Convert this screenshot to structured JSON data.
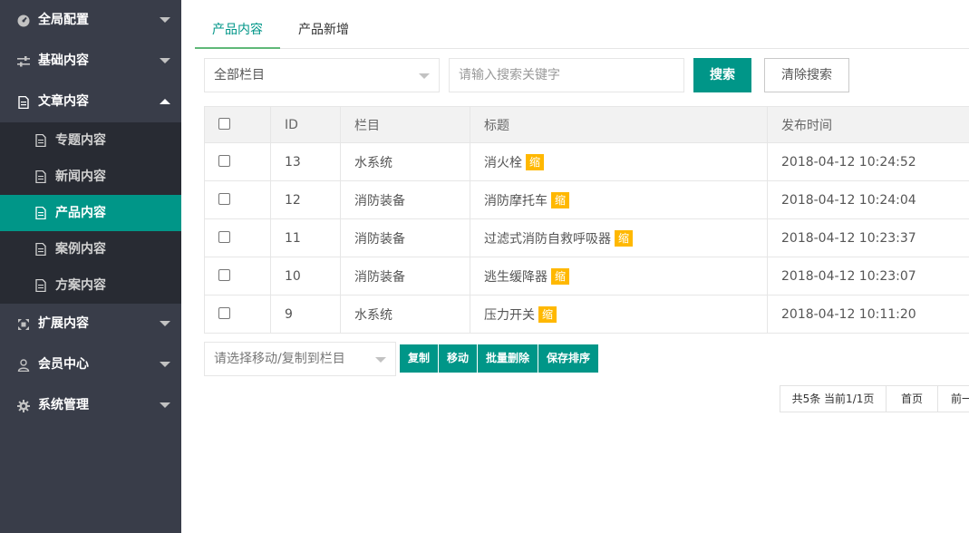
{
  "sidebar": {
    "items": [
      {
        "label": "全局配置",
        "icon": "gauge-icon"
      },
      {
        "label": "基础内容",
        "icon": "sliders-icon"
      },
      {
        "label": "文章内容",
        "icon": "document-icon"
      },
      {
        "label": "扩展内容",
        "icon": "expand-icon"
      },
      {
        "label": "会员中心",
        "icon": "user-icon"
      },
      {
        "label": "系统管理",
        "icon": "gear-icon"
      }
    ],
    "sub_items": [
      {
        "label": "专题内容"
      },
      {
        "label": "新闻内容"
      },
      {
        "label": "产品内容"
      },
      {
        "label": "案例内容"
      },
      {
        "label": "方案内容"
      }
    ]
  },
  "tabs": [
    {
      "label": "产品内容"
    },
    {
      "label": "产品新增"
    }
  ],
  "search": {
    "category_select": "全部栏目",
    "keyword_placeholder": "请输入搜索关键字",
    "search_button": "搜索",
    "clear_button": "清除搜索"
  },
  "table": {
    "headers": [
      "ID",
      "栏目",
      "标题",
      "发布时间"
    ],
    "tag_label": "缩",
    "rows": [
      {
        "id": "13",
        "category": "水系统",
        "title": "消火栓",
        "time": "2018-04-12 10:24:52"
      },
      {
        "id": "12",
        "category": "消防装备",
        "title": "消防摩托车",
        "time": "2018-04-12 10:24:04"
      },
      {
        "id": "11",
        "category": "消防装备",
        "title": "过滤式消防自救呼吸器",
        "time": "2018-04-12 10:23:37"
      },
      {
        "id": "10",
        "category": "消防装备",
        "title": "逃生缓降器",
        "time": "2018-04-12 10:23:07"
      },
      {
        "id": "9",
        "category": "水系统",
        "title": "压力开关",
        "time": "2018-04-12 10:11:20"
      }
    ]
  },
  "batch": {
    "move_select_placeholder": "请选择移动/复制到栏目",
    "copy_button": "复制",
    "move_button": "移动",
    "delete_button": "批量删除",
    "sort_button": "保存排序"
  },
  "pager": {
    "summary": "共5条 当前1/1页",
    "first": "首页",
    "prev": "前一"
  },
  "colors": {
    "sidebar_bg": "#393d49",
    "subnav_bg": "#282b33",
    "accent": "#009688",
    "tag": "#ffb800"
  }
}
